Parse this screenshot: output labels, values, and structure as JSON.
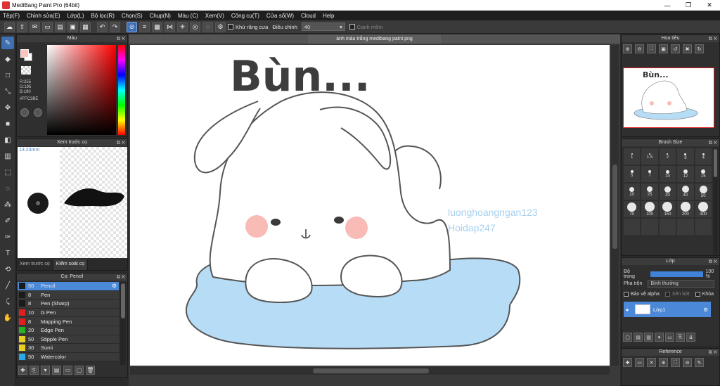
{
  "window": {
    "title": "MediBang Paint Pro (64bit)",
    "controls": [
      "—",
      "❐",
      "✕"
    ]
  },
  "menu": [
    "Tệp(F)",
    "Chỉnh sửa(E)",
    "Lớp(L)",
    "Bộ lọc(R)",
    "Chọn(S)",
    "Chụp(N)",
    "Màu (C)",
    "Xem(V)",
    "Công cụ(T)",
    "Cửa sổ(W)",
    "Cloud",
    "Help"
  ],
  "toolbar": {
    "antialias_label": "Khử răng cưa",
    "adjust_label": "Điều chỉnh",
    "adjust_value": "40",
    "edge_label": "Cạnh mềm"
  },
  "color_panel": {
    "title": "Màu",
    "rgb": [
      "R:255",
      "G:195",
      "B:190"
    ],
    "hex": "#FFC3BE",
    "fg_color": "#ffc3be",
    "bg_color": "#ffffff"
  },
  "preview_panel": {
    "title": "Xem trước cọ",
    "size": "13.23mm",
    "tabs": [
      "Xem trước cọ",
      "Kiểm soát cọ"
    ]
  },
  "brush_panel": {
    "title": "Cọ: Pencil",
    "brushes": [
      {
        "size": "50",
        "name": "Pencil",
        "color": "#1a1a1a"
      },
      {
        "size": "8",
        "name": "Pen",
        "color": "#1a1a1a"
      },
      {
        "size": "8",
        "name": "Pen (Sharp)",
        "color": "#1a1a1a"
      },
      {
        "size": "10",
        "name": "G Pen",
        "color": "#e02020"
      },
      {
        "size": "8",
        "name": "Mapping Pen",
        "color": "#e02020"
      },
      {
        "size": "20",
        "name": "Edge Pen",
        "color": "#28b028"
      },
      {
        "size": "50",
        "name": "Stipple Pen",
        "color": "#e8d020"
      },
      {
        "size": "30",
        "name": "Sumi",
        "color": "#e8d020"
      },
      {
        "size": "50",
        "name": "Watercolor",
        "color": "#2aa8e8"
      }
    ]
  },
  "document": {
    "tab_title": "ảnh màu trắng medibang paint.png",
    "headline": "Bùn...",
    "watermark_line1": "luonghoangngan123",
    "watermark_line2": "Hoidap247"
  },
  "navigator": {
    "title": "Hoa tiêu",
    "thumb_text": "Bùn..."
  },
  "brush_size_panel": {
    "title": "Brush Size",
    "sizes": [
      "1",
      "1.5",
      "2",
      "3",
      "4",
      "5",
      "7",
      "10",
      "12",
      "15",
      "20",
      "25",
      "30",
      "40",
      "50",
      "70",
      "100",
      "150",
      "200",
      "300",
      "",
      "",
      "",
      "",
      ""
    ]
  },
  "layer_panel": {
    "title": "Lớp",
    "opacity_label": "Độ trong",
    "opacity_value": "100 %",
    "opacity_fraction": 1.0,
    "blend_label": "Pha trộn",
    "blend_value": "Bình thường",
    "protect_alpha": "Bảo vệ alpha",
    "clipping": "Xén bớt",
    "lock": "Khóa",
    "layer_name": "Lớp1"
  },
  "reference_panel": {
    "title": "Reference"
  }
}
